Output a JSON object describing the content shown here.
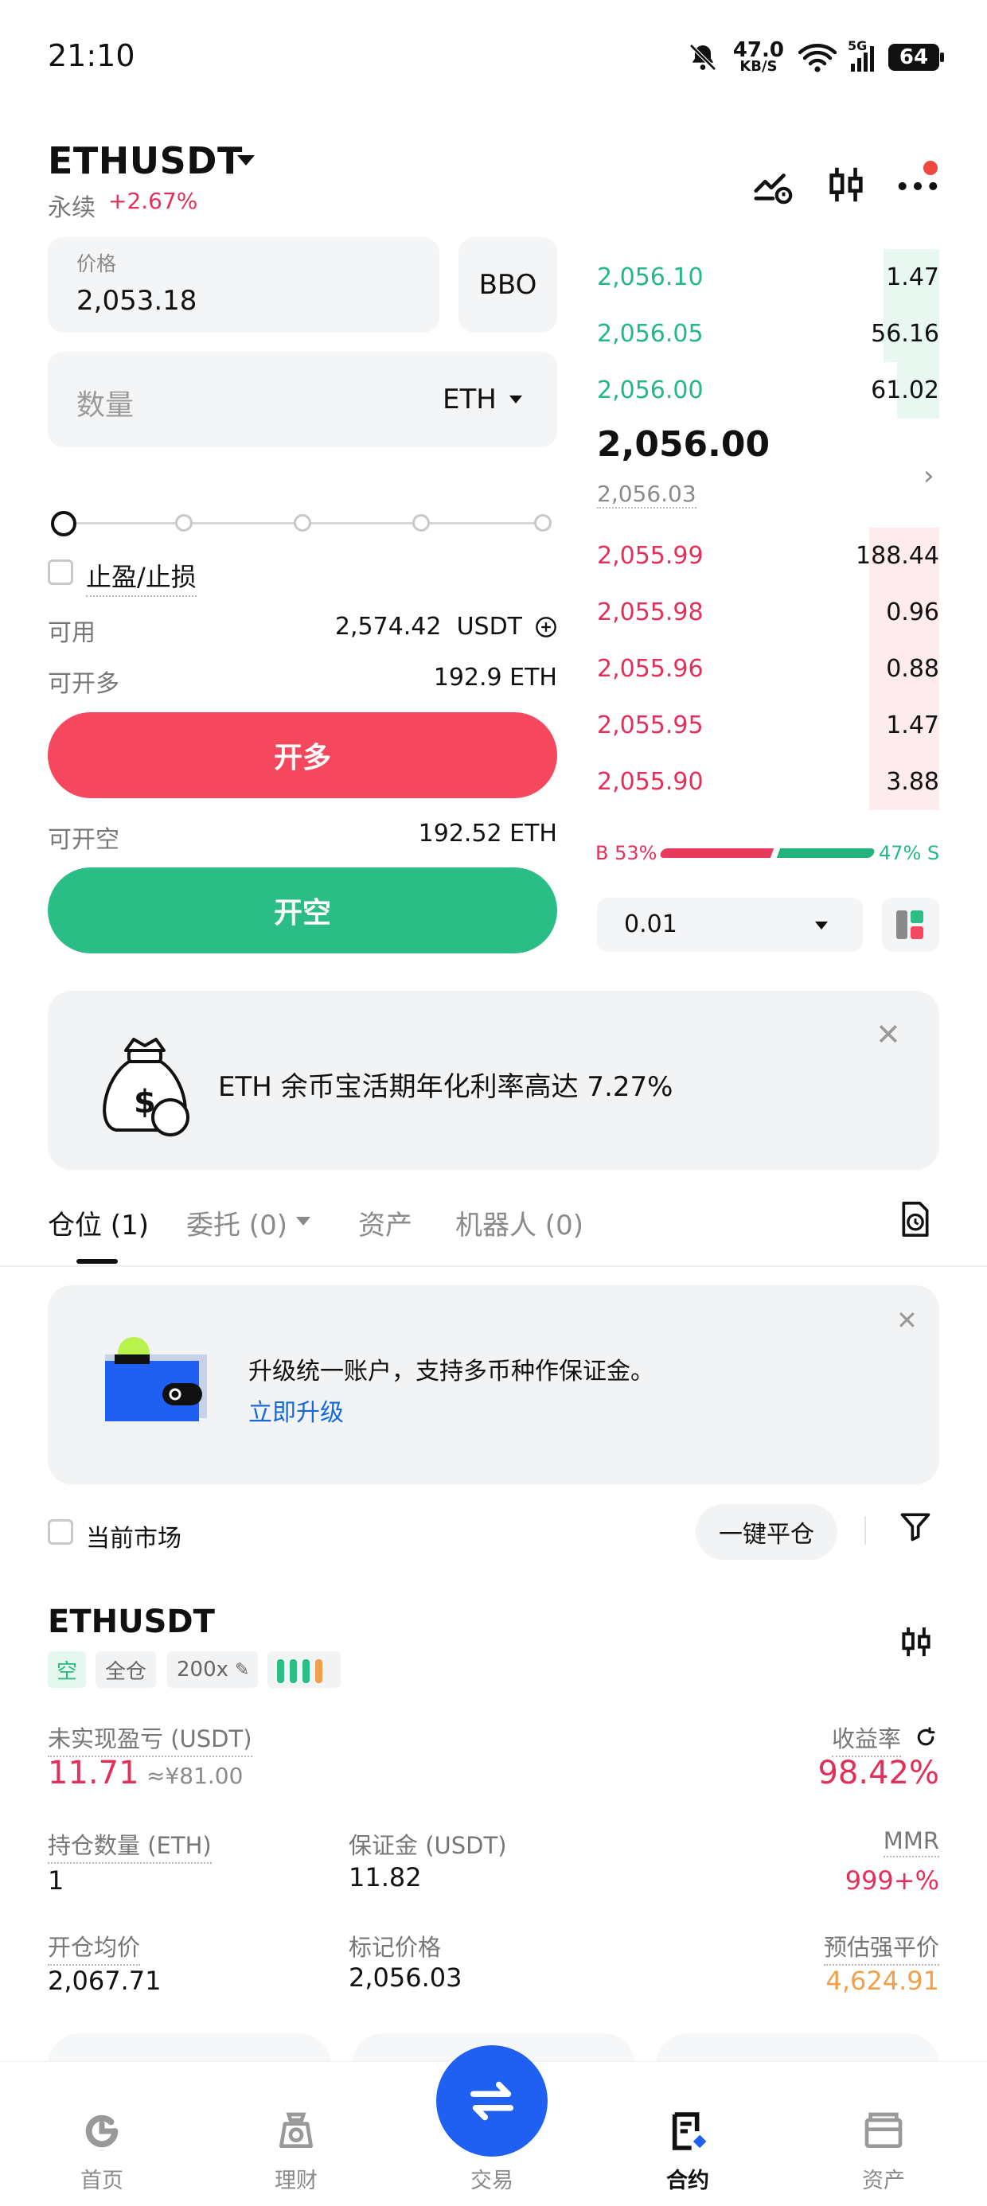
{
  "status_bar": {
    "time": "21:10",
    "net_speed": "47.0",
    "net_unit": "KB/S",
    "signal": "5G",
    "battery": "64"
  },
  "header": {
    "pair": "ETHUSDT",
    "type": "永续",
    "change": "+2.67%"
  },
  "order_form": {
    "price_caption": "价格",
    "price_value": "2,053.18",
    "bbo_label": "BBO",
    "qty_placeholder": "数量",
    "qty_unit": "ETH",
    "tpsl_label": "止盈/止损",
    "available_label": "可用",
    "available_value": "2,574.42",
    "available_unit": "USDT",
    "can_long_label": "可开多",
    "can_long_value": "192.9 ETH",
    "long_button": "开多",
    "can_short_label": "可开空",
    "can_short_value": "192.52 ETH",
    "short_button": "开空"
  },
  "order_book": {
    "asks": [
      {
        "price": "2,056.10",
        "qty": "1.47",
        "depth": 0.16
      },
      {
        "price": "2,056.05",
        "qty": "56.16",
        "depth": 0.16
      },
      {
        "price": "2,056.00",
        "qty": "61.02",
        "depth": 0.12
      }
    ],
    "last_price": "2,056.00",
    "mark_price": "2,056.03",
    "bids": [
      {
        "price": "2,055.99",
        "qty": "188.44",
        "depth": 0.2
      },
      {
        "price": "2,055.98",
        "qty": "0.96",
        "depth": 0.2
      },
      {
        "price": "2,055.96",
        "qty": "0.88",
        "depth": 0.2
      },
      {
        "price": "2,055.95",
        "qty": "1.47",
        "depth": 0.2
      },
      {
        "price": "2,055.90",
        "qty": "3.88",
        "depth": 0.2
      }
    ],
    "buy_ratio": "B 53%",
    "sell_ratio": "47% S",
    "depth_step": "0.01"
  },
  "promo": {
    "text": "ETH 余币宝活期年化利率高达 7.27%"
  },
  "tabs": [
    {
      "label": "仓位 (1)"
    },
    {
      "label": "委托 (0)"
    },
    {
      "label": "资产"
    },
    {
      "label": "机器人 (0)"
    }
  ],
  "upgrade_banner": {
    "text": "升级统一账户，支持多币种作保证金。",
    "link": "立即升级"
  },
  "filters": {
    "current_market": "当前市场",
    "close_all": "一键平仓"
  },
  "position": {
    "symbol": "ETHUSDT",
    "side_tag": "空",
    "margin_tag": "全仓",
    "leverage_tag": "200x",
    "pnl_label": "未实现盈亏 (USDT)",
    "pnl_value": "11.71",
    "pnl_cny": "≈¥81.00",
    "roe_label": "收益率",
    "roe_value": "98.42%",
    "size_label": "持仓数量 (ETH)",
    "size_value": "1",
    "margin_label": "保证金 (USDT)",
    "margin_value": "11.82",
    "mmr_label": "MMR",
    "mmr_value": "999+%",
    "entry_label": "开仓均价",
    "entry_value": "2,067.71",
    "mark_label": "标记价格",
    "mark_value": "2,056.03",
    "liq_label": "预估强平价",
    "liq_value": "4,624.91"
  },
  "bottom_nav": {
    "home": "首页",
    "earn": "理财",
    "trade": "交易",
    "futures": "合约",
    "assets": "资产"
  },
  "colors": {
    "long": "#f5485e",
    "short": "#2bbd86",
    "accent": "#1f5ff2"
  }
}
